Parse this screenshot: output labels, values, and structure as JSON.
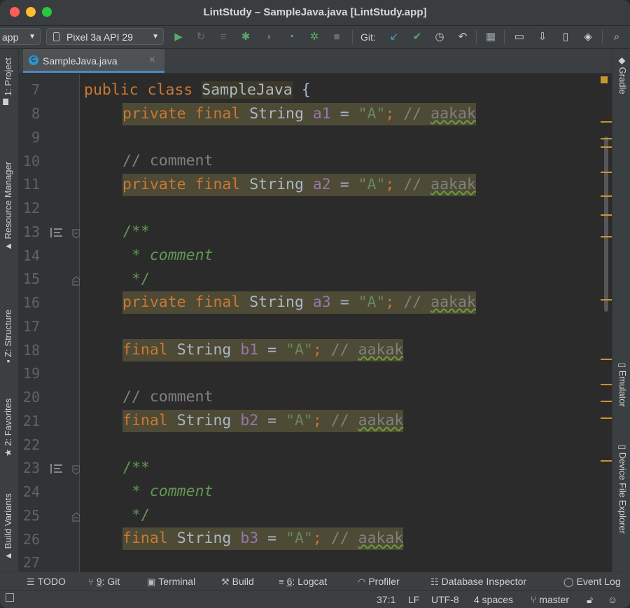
{
  "window": {
    "title": "LintStudy – SampleJava.java [LintStudy.app]"
  },
  "toolbar": {
    "module": "app",
    "device": "Pixel 3a API 29",
    "git_label": "Git:"
  },
  "left_strip": [
    "1: Project",
    "Resource Manager",
    "Z: Structure",
    "2: Favorites",
    "Build Variants"
  ],
  "right_strip": [
    "Gradle",
    "Emulator",
    "Device File Explorer"
  ],
  "tab": {
    "label": "SampleJava.java",
    "icon_letter": "C"
  },
  "editor": {
    "lines": [
      {
        "n": "7"
      },
      {
        "n": "8"
      },
      {
        "n": "9"
      },
      {
        "n": "10"
      },
      {
        "n": "11"
      },
      {
        "n": "12"
      },
      {
        "n": "13"
      },
      {
        "n": "14"
      },
      {
        "n": "15"
      },
      {
        "n": "16"
      },
      {
        "n": "17"
      },
      {
        "n": "18"
      },
      {
        "n": "19"
      },
      {
        "n": "20"
      },
      {
        "n": "21"
      },
      {
        "n": "22"
      },
      {
        "n": "23"
      },
      {
        "n": "24"
      },
      {
        "n": "25"
      },
      {
        "n": "26"
      },
      {
        "n": "27"
      }
    ],
    "code": {
      "l7_kw": "public class",
      "l7_cls": "SampleJava",
      "l7_brace": " {",
      "mod_pf": "private final",
      "mod_f": "final",
      "type": "String",
      "eq": " = ",
      "str_val": "\"A\"",
      "semi": ";",
      "cmt_prefix": " // ",
      "todo_word": "aakak",
      "line_comment": "// comment",
      "doc_open": "/**",
      "doc_mid": " * ",
      "doc_word": "comment",
      "doc_close": " */",
      "f_a1": "a1",
      "f_a2": "a2",
      "f_a3": "a3",
      "f_b1": "b1",
      "f_b2": "b2",
      "f_b3": "b3"
    }
  },
  "bottom_tools": {
    "todo": "TODO",
    "git_num": "9",
    "git": ": Git",
    "terminal": "Terminal",
    "build": "Build",
    "logcat_num": "6",
    "logcat": ": Logcat",
    "profiler": "Profiler",
    "db": "Database Inspector",
    "event": "Event Log"
  },
  "status": {
    "position": "37:1",
    "line_sep": "LF",
    "encoding": "UTF-8",
    "indent": "4 spaces",
    "branch": "master"
  },
  "colors": {
    "keyword": "#cc7832",
    "string": "#6a8759",
    "field": "#9876aa",
    "comment": "#808080",
    "doc_comment": "#629755",
    "highlight": "#4d4a36",
    "marker": "#c8962e"
  }
}
